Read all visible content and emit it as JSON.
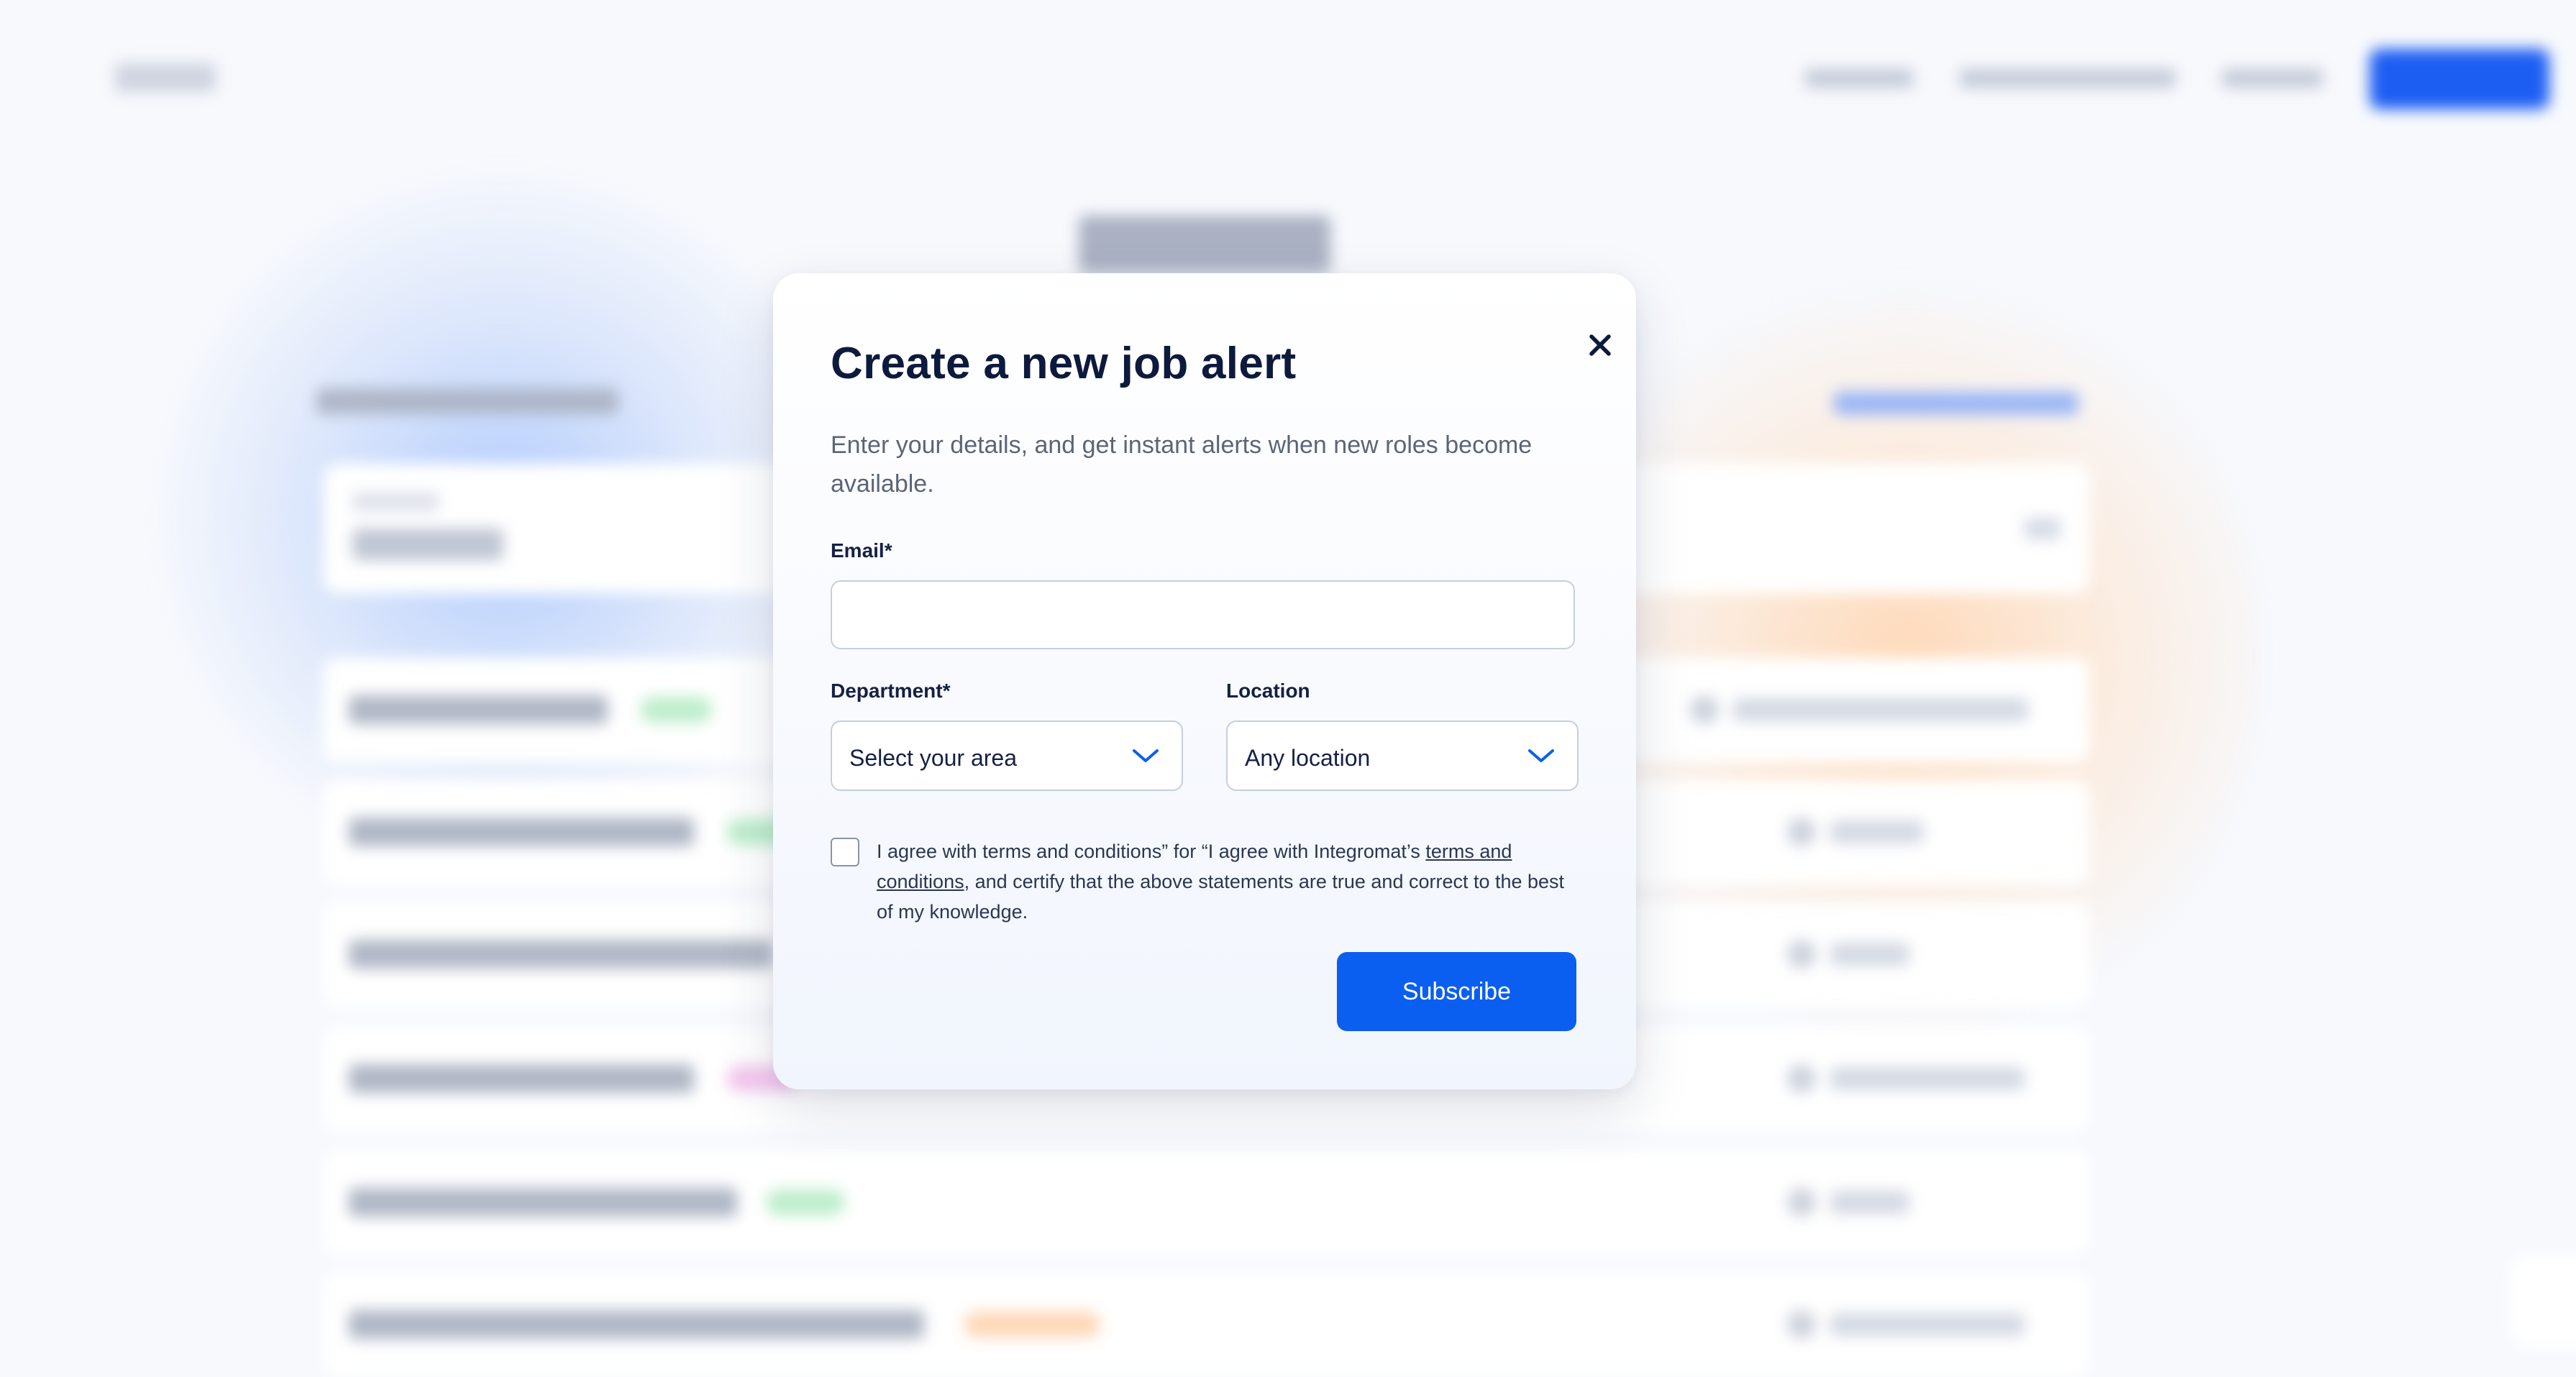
{
  "modal": {
    "title": "Create a new job alert",
    "description": "Enter your details, and get instant alerts when new roles become available.",
    "email": {
      "label": "Email*",
      "value": "",
      "placeholder": ""
    },
    "department": {
      "label": "Department*",
      "selected": "Select your area",
      "icon": "chevron-down-icon"
    },
    "location": {
      "label": "Location",
      "selected": "Any location",
      "icon": "chevron-down-icon"
    },
    "consent": {
      "checked": false,
      "text_before": "I agree with terms and conditions” for “I agree with Integromat’s ",
      "link_text": "terms and conditions",
      "text_after": ", and certify that the above statements are true and correct to the best of my knowledge."
    },
    "submit_label": "Subscribe",
    "close_icon": "close-icon"
  },
  "colors": {
    "accent": "#0a5ff0",
    "title": "#0d1a3d",
    "body_text": "#5c6477"
  }
}
